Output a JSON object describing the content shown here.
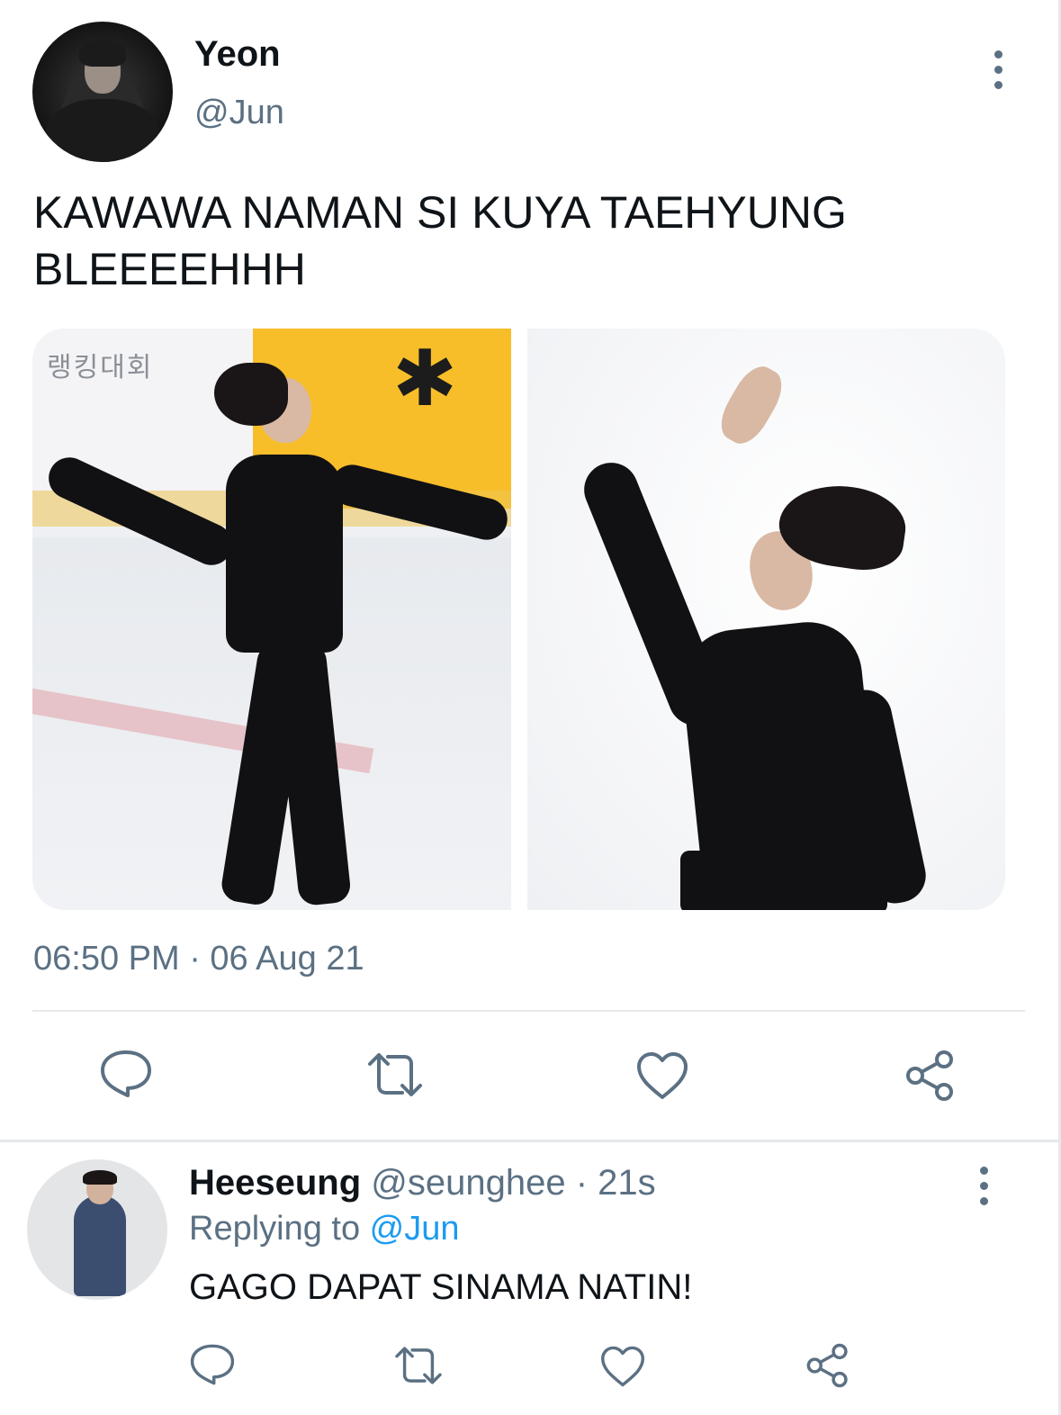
{
  "tweet": {
    "display_name": "Yeon",
    "handle": "@Jun",
    "text": "KAWAWA NAMAN SI KUYA TAEHYUNG BLEEEEHHH",
    "media": {
      "photo_1_sign_text": "랭킹대회",
      "photo_1_logo_text": "✱"
    },
    "timestamp": "06:50 PM · 06 Aug 21",
    "actions": [
      "reply",
      "retweet",
      "like",
      "share"
    ]
  },
  "reply": {
    "display_name": "Heeseung",
    "handle": "@seunghee",
    "time": " · 21s",
    "replying_prefix": "Replying to ",
    "replying_to": "@Jun",
    "text": "GAGO DAPAT SINAMA NATIN!",
    "actions": [
      "reply",
      "retweet",
      "like",
      "share"
    ]
  },
  "colors": {
    "text_primary": "#0f1419",
    "text_secondary": "#5b7083",
    "link": "#1d9bf0",
    "divider": "#e6e9ec"
  },
  "icons": {
    "more": "more-vertical-icon",
    "reply": "comment-bubble-icon",
    "retweet": "retweet-icon",
    "like": "heart-outline-icon",
    "share": "share-nodes-icon"
  }
}
